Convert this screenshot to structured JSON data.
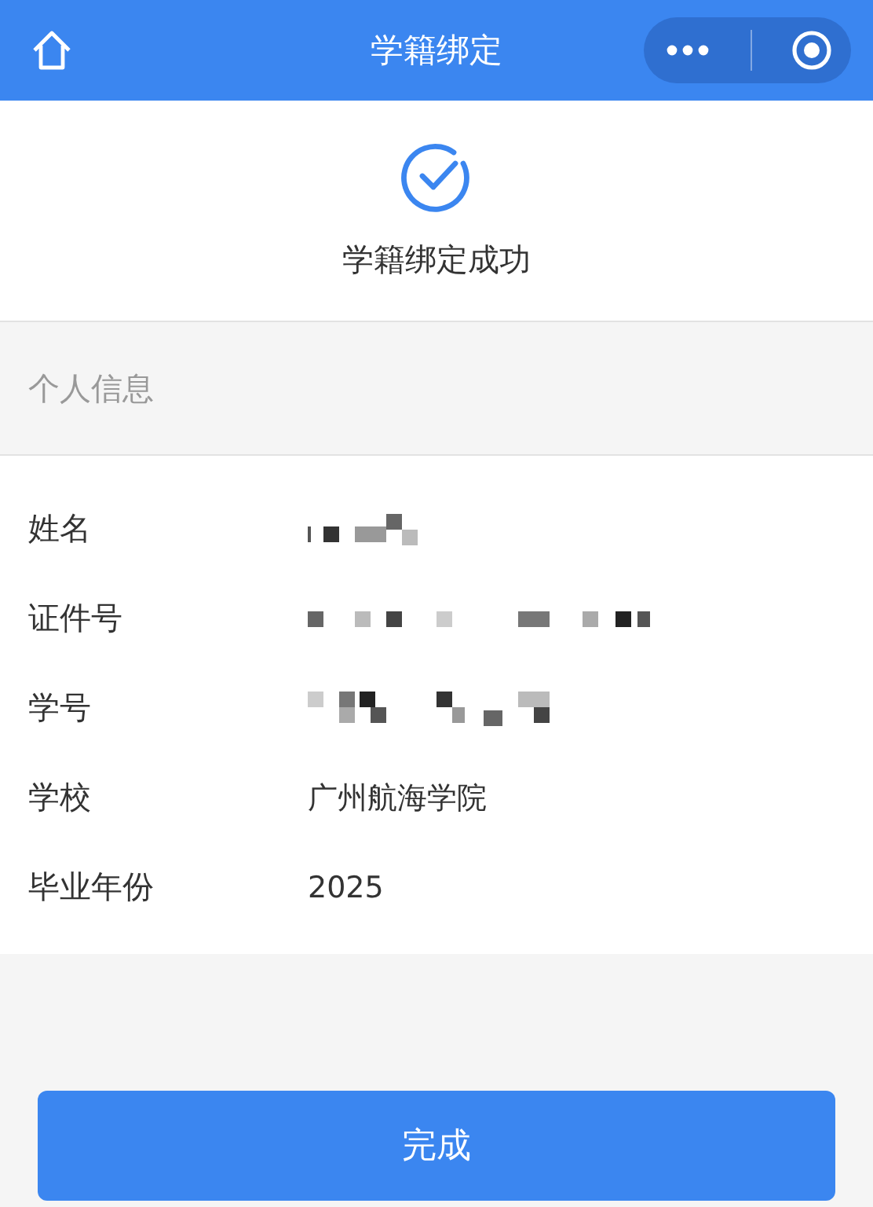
{
  "nav": {
    "title": "学籍绑定"
  },
  "result": {
    "message": "学籍绑定成功"
  },
  "section": {
    "title": "个人信息"
  },
  "rows": [
    {
      "label": "姓名",
      "kind": "masked"
    },
    {
      "label": "证件号",
      "kind": "masked"
    },
    {
      "label": "学号",
      "kind": "masked"
    },
    {
      "label": "学校",
      "kind": "text",
      "value": "广州航海学院"
    },
    {
      "label": "毕业年份",
      "kind": "text",
      "value": "2025"
    }
  ],
  "button": {
    "label": "完成"
  }
}
